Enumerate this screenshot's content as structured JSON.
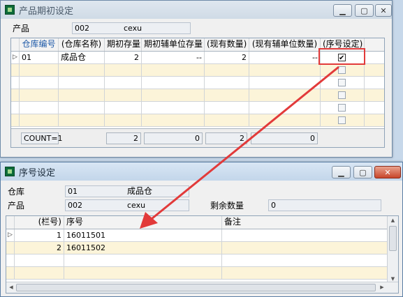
{
  "win1": {
    "title": "产品期初设定",
    "product_label": "产品",
    "product_code": "002",
    "product_name": "cexu",
    "columns": [
      "仓库编号",
      "(仓库名称)",
      "期初存量",
      "期初辅单位存量",
      "(现有数量)",
      "(现有辅单位数量)",
      "(序号设定)"
    ],
    "row": {
      "code": "01",
      "name": "成品仓",
      "init_qty": "2",
      "init_aux": "--",
      "cur_qty": "2",
      "cur_aux": "--"
    },
    "count_label": "COUNT=1",
    "totals": [
      "2",
      "0",
      "2",
      "0"
    ]
  },
  "win2": {
    "title": "序号设定",
    "warehouse_label": "仓库",
    "warehouse_code": "01",
    "warehouse_name": "成品仓",
    "product_label": "产品",
    "product_code": "002",
    "product_name": "cexu",
    "remaining_label": "剩余数量",
    "remaining_value": "0",
    "columns": [
      "(栏号)",
      "序号",
      "备注"
    ],
    "rows": [
      {
        "no": "1",
        "serial": "16011501",
        "note": ""
      },
      {
        "no": "2",
        "serial": "16011502",
        "note": ""
      }
    ]
  },
  "colors": {
    "highlight": "#e23a3a",
    "alt_row": "#fcf4d9",
    "title_bar": "#c3d6ea"
  }
}
